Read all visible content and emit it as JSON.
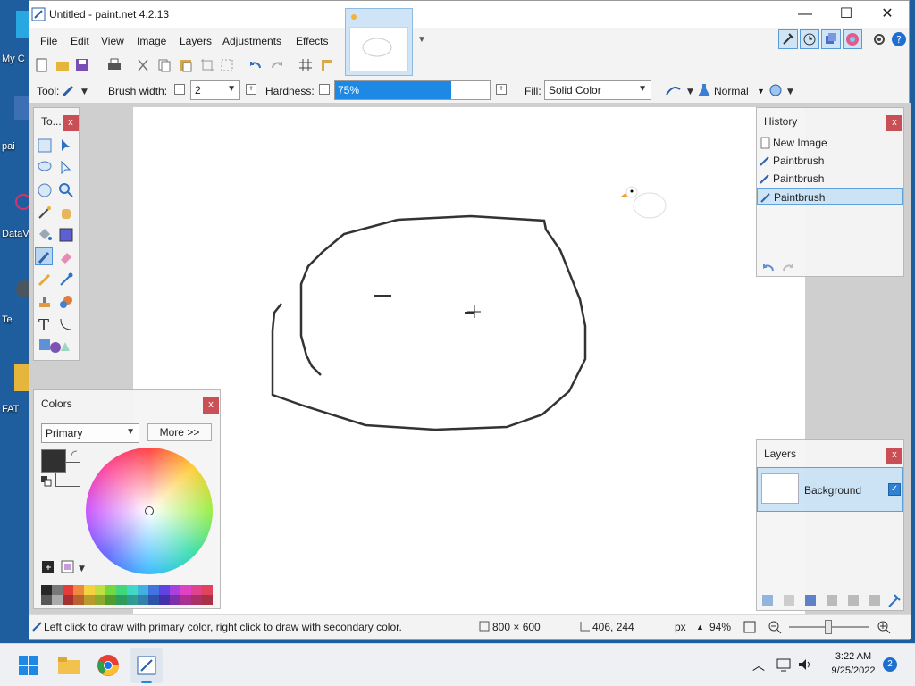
{
  "desktop": {
    "icons": [
      {
        "label": "My C"
      },
      {
        "label": "pai"
      },
      {
        "label": "DataV"
      },
      {
        "label": "Te"
      },
      {
        "label": "FAT"
      }
    ]
  },
  "window": {
    "title": "Untitled - paint.net 4.2.13",
    "controls": {
      "minimize": "—",
      "maximize": "☐",
      "close": "✕"
    }
  },
  "menu": {
    "items": [
      "File",
      "Edit",
      "View",
      "Image",
      "Layers",
      "Adjustments",
      "Effects"
    ]
  },
  "toolbar": {
    "tool_label": "Tool:",
    "brush_width_label": "Brush width:",
    "brush_width_value": "2",
    "hardness_label": "Hardness:",
    "hardness_value": "75%",
    "hardness_fraction": 0.75,
    "fill_label": "Fill:",
    "fill_value": "Solid Color",
    "blend_mode": "Normal"
  },
  "tools_panel": {
    "title": "To..."
  },
  "colors_panel": {
    "title": "Colors",
    "mode": "Primary",
    "more_label": "More >>"
  },
  "history_panel": {
    "title": "History",
    "items": [
      "New Image",
      "Paintbrush",
      "Paintbrush",
      "Paintbrush"
    ],
    "selected_index": 3
  },
  "layers_panel": {
    "title": "Layers",
    "layers": [
      {
        "name": "Background",
        "visible": true
      }
    ]
  },
  "status": {
    "hint": "Left click to draw with primary color, right click to draw with secondary color.",
    "image_size": "800 × 600",
    "cursor_pos": "406, 244",
    "units": "px",
    "zoom": "94%"
  },
  "taskbar": {
    "time": "3:22 AM",
    "date": "9/25/2022",
    "notifications": "2"
  },
  "colors": {
    "accent": "#1e88e5",
    "primary_color": "#2b2b2b",
    "secondary_color": "#f5f5f5",
    "close_red": "#c94a52"
  }
}
